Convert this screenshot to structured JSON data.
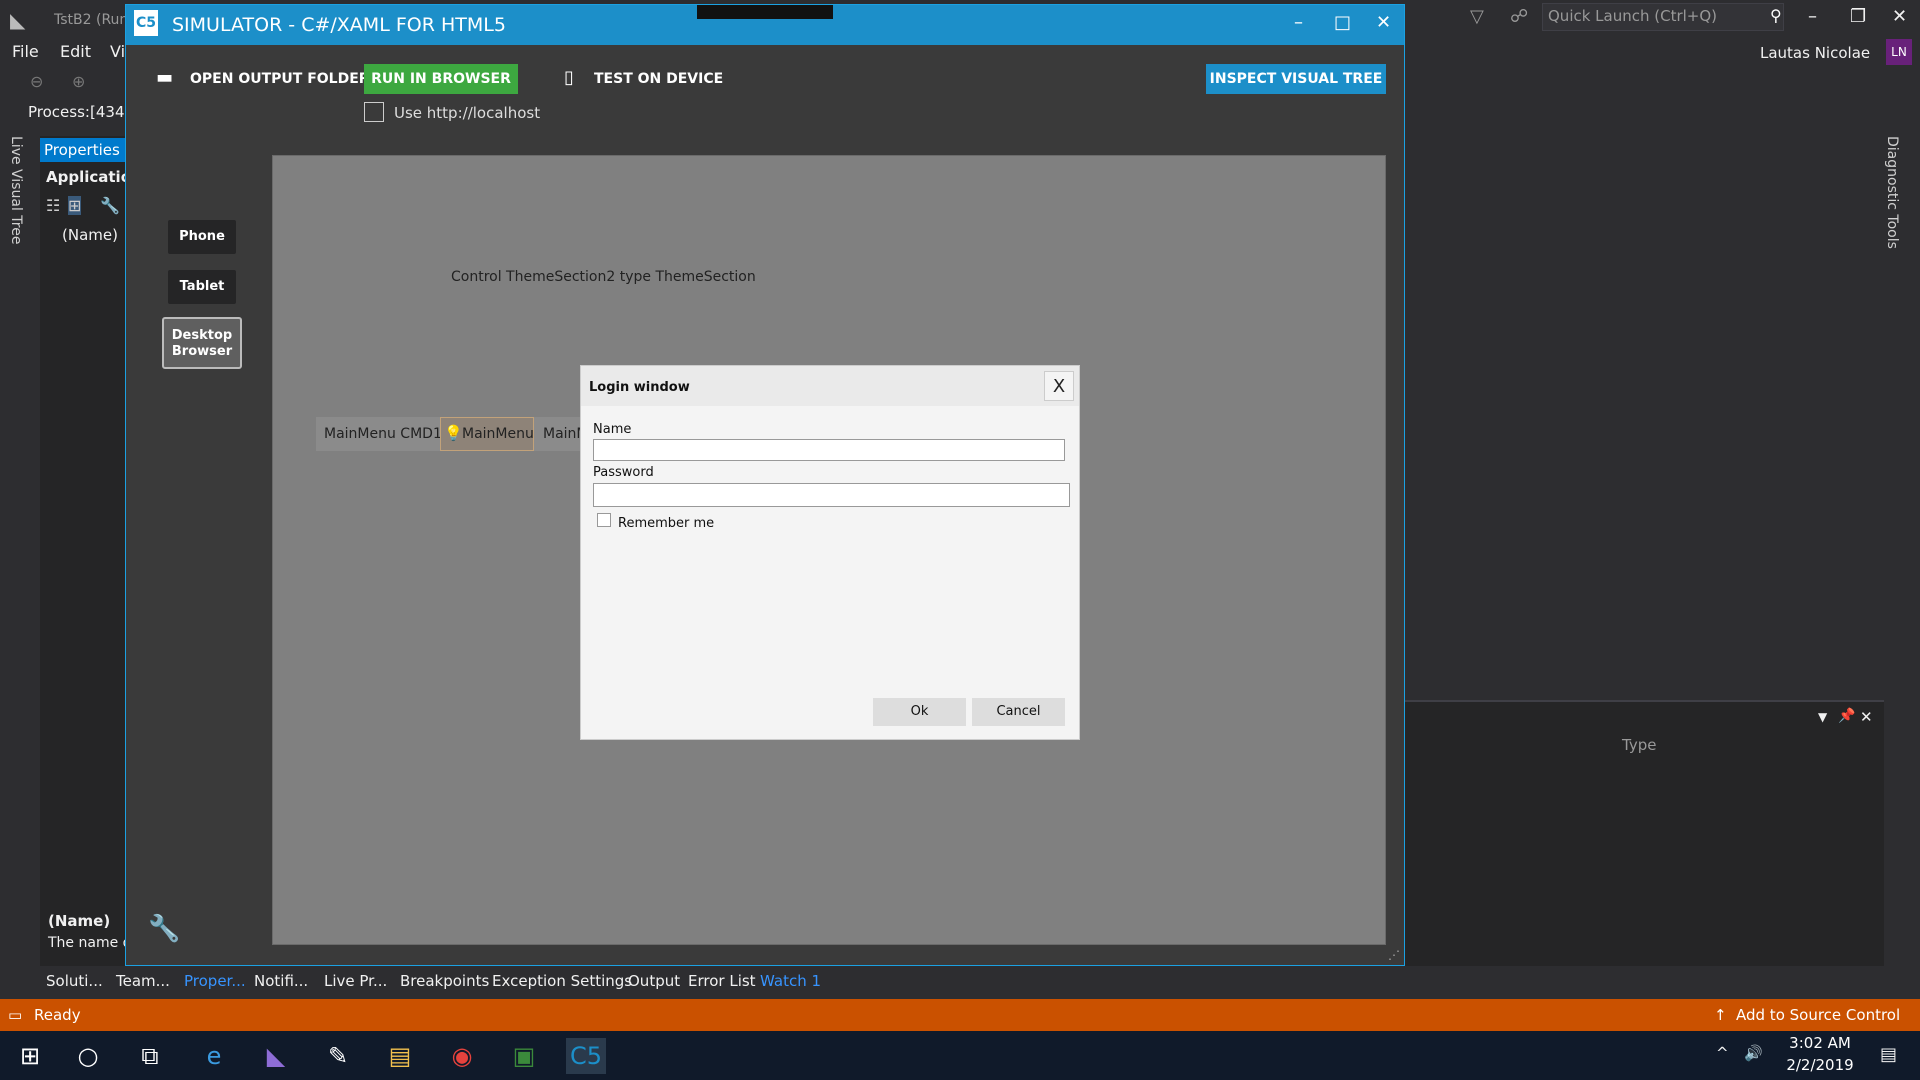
{
  "vs": {
    "title": "TstB2 (Run",
    "menu": [
      "File",
      "Edit",
      "Vi"
    ],
    "quick_launch_placeholder": "Quick Launch (Ctrl+Q)",
    "user_name": "Lautas Nicolae",
    "user_initials": "LN",
    "process_label": "Process:",
    "process_value": "[434",
    "live_visual_tree": "Live Visual Tree",
    "diagnostic_tools": "Diagnostic Tools",
    "properties": {
      "tab_label": "Properties",
      "app": "Application",
      "name_field": "(Name)",
      "desc_title": "(Name)",
      "desc_text": "The name o"
    },
    "right_pane": {
      "type_header": "Type"
    },
    "bottom_tabs": [
      "Soluti...",
      "Team...",
      "Proper...",
      "Notifi...",
      "Live Pr...",
      "Breakpoints",
      "Exception Settings",
      "Output",
      "Error List",
      "Watch 1"
    ],
    "status": {
      "ready": "Ready",
      "source_control": "Add to Source Control"
    }
  },
  "taskbar": {
    "time": "3:02 AM",
    "date": "2/2/2019"
  },
  "simulator": {
    "logo": "C5",
    "title": "SIMULATOR - C#/XAML FOR HTML5",
    "open_output": "OPEN OUTPUT FOLDER",
    "run_browser": "RUN IN BROWSER",
    "test_device": "TEST ON DEVICE",
    "use_localhost": "Use http://localhost",
    "inspect": "INSPECT VISUAL TREE",
    "devices": {
      "phone": "Phone",
      "tablet": "Tablet",
      "desktop": "Desktop Browser"
    }
  },
  "app": {
    "control_label": "Control ThemeSection2 type ThemeSection",
    "menu_cmd1": "MainMenu CMD1",
    "menu_main": "MainMenu",
    "menu_partial": "MainM"
  },
  "login": {
    "title": "Login window",
    "close": "X",
    "name_label": "Name",
    "name_value": "",
    "password_label": "Password",
    "password_value": "",
    "remember_label": "Remember me",
    "ok": "Ok",
    "cancel": "Cancel"
  }
}
